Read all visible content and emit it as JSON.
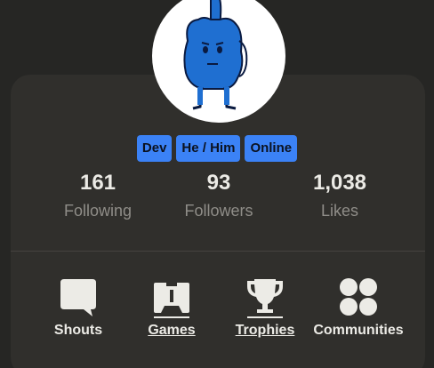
{
  "badges": [
    "Dev",
    "He / Him",
    "Online"
  ],
  "stats": {
    "following": {
      "value": "161",
      "label": "Following"
    },
    "followers": {
      "value": "93",
      "label": "Followers"
    },
    "likes": {
      "value": "1,038",
      "label": "Likes"
    }
  },
  "nav": {
    "shouts": {
      "label": "Shouts",
      "icon": "speech-bubble-icon"
    },
    "games": {
      "label": "Games",
      "icon": "gamepad-icon"
    },
    "trophies": {
      "label": "Trophies",
      "icon": "trophy-icon"
    },
    "communities": {
      "label": "Communities",
      "icon": "four-circles-icon"
    }
  },
  "colors": {
    "background": "#262624",
    "card": "#302f2c",
    "badge": "#3b82f6",
    "text": "#ecebe6",
    "muted": "#8f8d88"
  }
}
